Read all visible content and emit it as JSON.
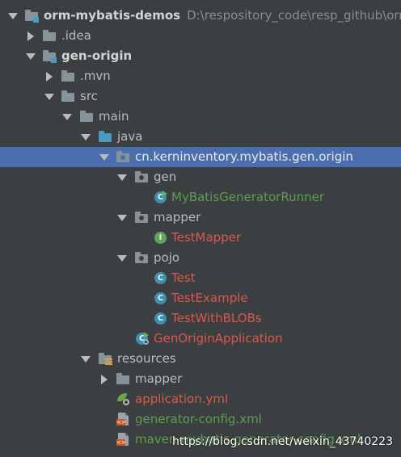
{
  "project": {
    "name": "orm-mybatis-demos",
    "path": "D:\\respository_code\\resp_github\\orm"
  },
  "tree": {
    "idea": ".idea",
    "gen_origin": "gen-origin",
    "mvn": ".mvn",
    "src": "src",
    "main": "main",
    "java": "java",
    "package": "cn.kerninventory.mybatis.gen.origin",
    "gen": "gen",
    "runner": "MyBatisGeneratorRunner",
    "mapper_pkg": "mapper",
    "test_mapper": "TestMapper",
    "pojo": "pojo",
    "test": "Test",
    "test_example": "TestExample",
    "test_with_blobs": "TestWithBLOBs",
    "app": "GenOriginApplication",
    "resources": "resources",
    "res_mapper": "mapper",
    "app_yml": "application.yml",
    "gen_config": "generator-config.xml",
    "maven_config": "maven-mybatis-generator-config.xml"
  },
  "icons": {
    "class": "C",
    "interface": "I",
    "xml_badge": "<>"
  },
  "watermark": "https://blog.csdn.net/weixin_43740223",
  "colors": {
    "background": "#3c3f41",
    "selection": "#4b6eaf",
    "added_green": "#5d9e4e",
    "modified_red": "#d9584b"
  }
}
